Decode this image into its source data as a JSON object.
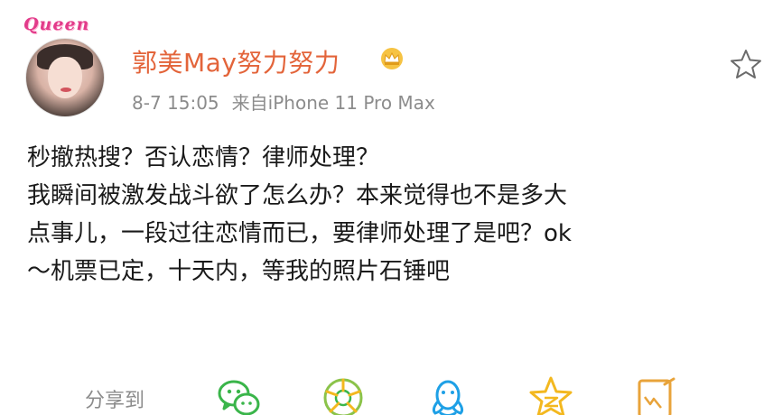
{
  "post": {
    "avatar_tag": "Queen",
    "user_name": "郭美May努力努力",
    "timestamp": "8-7 15:05",
    "source": "来自iPhone 11 Pro Max",
    "body_lines": [
      "秒撤热搜？否认恋情？律师处理？",
      "我瞬间被激发战斗欲了怎么办？本来觉得也不是多大",
      "点事儿，一段过往恋情而已，要律师处理了是吧？ok",
      "～机票已定，十天内，等我的照片石锤吧"
    ]
  },
  "share": {
    "label": "分享到",
    "targets": [
      {
        "icon": "wechat-icon",
        "color": "#3ab54a"
      },
      {
        "icon": "wechat-moments-icon",
        "color": "#8bc34a"
      },
      {
        "icon": "qq-icon",
        "color": "#1ea0e6"
      },
      {
        "icon": "qzone-icon",
        "color": "#f3b81f"
      },
      {
        "icon": "note-icon",
        "color": "#e8a33a"
      }
    ]
  },
  "colors": {
    "username": "#e3643a",
    "meta": "#8c8c8c",
    "body_text": "#1a1a1a"
  }
}
